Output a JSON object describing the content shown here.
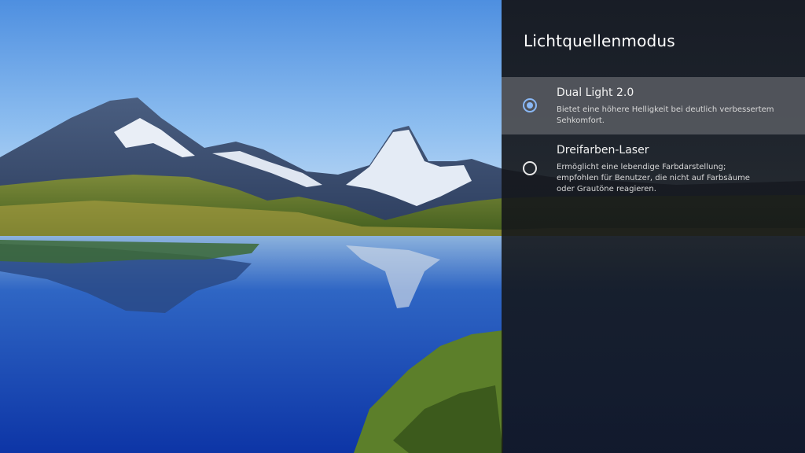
{
  "panel": {
    "title": "Lichtquellenmodus",
    "options": [
      {
        "label": "Dual Light 2.0",
        "description": "Bietet eine höhere Helligkeit bei deutlich verbessertem Sehkomfort.",
        "selected": true
      },
      {
        "label": "Dreifarben-Laser",
        "description_lines": [
          "Ermöglicht eine lebendige Farbdarstellung;",
          "empfohlen für Benutzer, die nicht auf Farbsäume",
          "oder Grautöne reagieren."
        ],
        "selected": false
      }
    ]
  },
  "colors": {
    "accent": "#8ab8f5",
    "panel_bg": "#16181e",
    "highlight_bg": "#5f6268"
  },
  "icons": {
    "selected_radio": "radio-selected-icon",
    "unselected_radio": "radio-unselected-icon"
  }
}
